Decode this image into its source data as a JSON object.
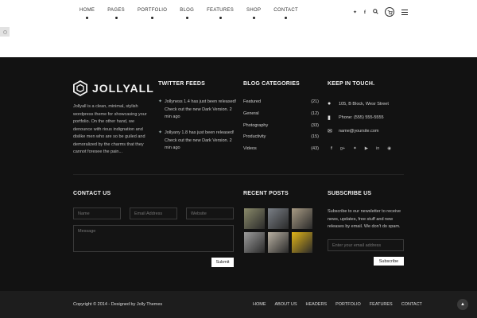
{
  "header": {
    "nav": [
      "HOME",
      "PAGES",
      "PORTFOLIO",
      "BLOG",
      "FEATURES",
      "SHOP",
      "CONTACT"
    ],
    "social_icons": [
      "twitter-icon",
      "facebook-icon",
      "search-icon"
    ],
    "cart_icon": "cart-icon",
    "menu_icon": "hamburger-menu-icon"
  },
  "brand": {
    "name": "JOLLYALL",
    "about": "Jollyall is a clean, minimal, stylish wordpress theme for showcasing your portfolio. On the other hand, we denounce with rious indignation and dislike men who are so be guiled and demoralized by the charms that they cannot foresee the pain..."
  },
  "twitter": {
    "title": "TWITTER FEEDS",
    "tweets": [
      "Jollyness 1.4 has just been released! Check out the new Dark Version. 2 min ago",
      "Jollyany 1.8 has just been released! Check out the new Dark Version. 2 min ago"
    ]
  },
  "categories": {
    "title": "BLOG CATEGORIES",
    "items": [
      {
        "name": "Featured",
        "count": "(21)"
      },
      {
        "name": "General",
        "count": "(12)"
      },
      {
        "name": "Photography",
        "count": "(33)"
      },
      {
        "name": "Productivity",
        "count": "(15)"
      },
      {
        "name": "Videos",
        "count": "(43)"
      }
    ]
  },
  "keep_in_touch": {
    "title": "KEEP IN TOUCH.",
    "address": "105, B Block, Wesr Street",
    "phone": "Phone: (555) 555-5555",
    "email": "name@yoursite.com",
    "social": [
      "facebook-icon",
      "google-plus-icon",
      "twitter-icon",
      "youtube-icon",
      "linkedin-icon",
      "dribbble-icon"
    ]
  },
  "contact": {
    "title": "CONTACT US",
    "name_placeholder": "Name",
    "email_placeholder": "Email Address",
    "website_placeholder": "Website",
    "message_placeholder": "Message",
    "submit_label": "Submit"
  },
  "recent_posts": {
    "title": "RECENT POSTS",
    "thumb_colors": [
      "#8a8a6a",
      "#7a7f86",
      "#a89b84",
      "#9c9c9c",
      "#b8b0a2",
      "#e0b418"
    ]
  },
  "subscribe": {
    "title": "SUBSCRIBE US",
    "text": "Subscribe to our newsletter to receive news, updates, free stuff and new releases by email. We don't do spam.",
    "placeholder": "Enter your email address",
    "button_label": "Subscribe"
  },
  "footer": {
    "copyright": "Copyright © 2014 - Designed by Jolly Themes",
    "nav": [
      "HOME",
      "ABOUT US",
      "HEADERS",
      "PORTFOLIO",
      "FEATURES",
      "CONTACT"
    ]
  },
  "colors": {
    "background": "#121212",
    "header": "#ffffff",
    "bottom_bar": "#1d1d1d"
  }
}
